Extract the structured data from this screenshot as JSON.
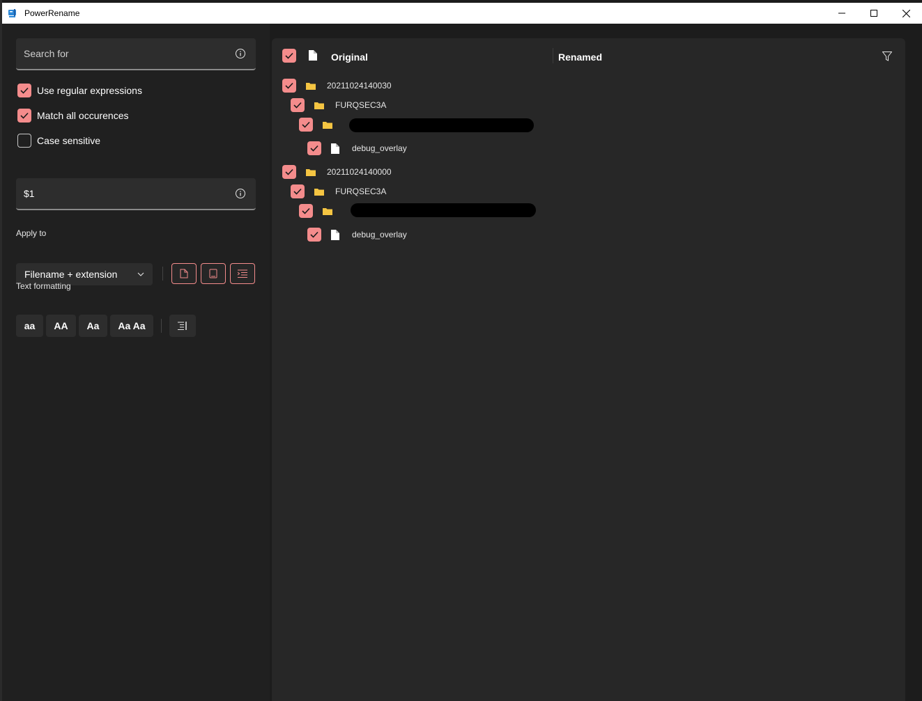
{
  "window": {
    "title": "PowerRename"
  },
  "search": {
    "placeholder": "Search for",
    "value": ""
  },
  "options": [
    {
      "label": "Use regular expressions",
      "checked": true
    },
    {
      "label": "Match all occurences",
      "checked": true
    },
    {
      "label": "Case sensitive",
      "checked": false
    }
  ],
  "replace": {
    "value": "$1"
  },
  "apply_to": {
    "label": "Apply to",
    "selected": "Filename + extension"
  },
  "text_formatting": {
    "label": "Text formatting",
    "buttons": [
      "aa",
      "AA",
      "Aa",
      "Aa Aa"
    ]
  },
  "list": {
    "col_original": "Original",
    "col_renamed": "Renamed",
    "rows": [
      {
        "name": "20211024140030",
        "type": "folder",
        "checked": true
      },
      {
        "name": "FURQSEC3A",
        "type": "folder",
        "checked": true
      },
      {
        "name": "",
        "type": "folder",
        "checked": true,
        "redacted": true
      },
      {
        "name": "debug_overlay",
        "type": "file",
        "checked": true
      },
      {
        "name": "20211024140000",
        "type": "folder",
        "checked": true
      },
      {
        "name": "FURQSEC3A",
        "type": "folder",
        "checked": true
      },
      {
        "name": "",
        "type": "folder",
        "checked": true,
        "redacted": true
      },
      {
        "name": "debug_overlay",
        "type": "file",
        "checked": true
      }
    ]
  },
  "colors": {
    "accent": "#f48c8c",
    "folder": "#f5c542"
  }
}
